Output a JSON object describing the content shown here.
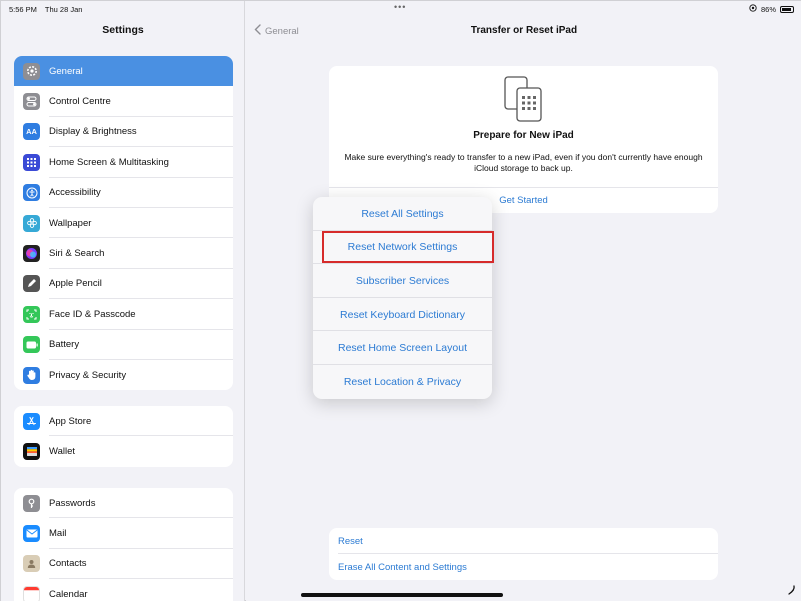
{
  "status": {
    "time": "5:56 PM",
    "date": "Thu 28 Jan",
    "battery": "86%",
    "dots": "•••"
  },
  "sidebar": {
    "title": "Settings",
    "groups": [
      [
        {
          "label": "General",
          "icon": "gear-icon",
          "color": "#8e8e93"
        },
        {
          "label": "Control Centre",
          "icon": "toggles-icon",
          "color": "#8e8e93"
        },
        {
          "label": "Display & Brightness",
          "icon": "text-size-icon",
          "color": "#2f7de1"
        },
        {
          "label": "Home Screen & Multitasking",
          "icon": "grid-icon",
          "color": "#3b4ad6"
        },
        {
          "label": "Accessibility",
          "icon": "accessibility-icon",
          "color": "#2f7de1"
        },
        {
          "label": "Wallpaper",
          "icon": "flower-icon",
          "color": "#36a9d6"
        },
        {
          "label": "Siri & Search",
          "icon": "siri-icon",
          "color": "#222222"
        },
        {
          "label": "Apple Pencil",
          "icon": "pencil-icon",
          "color": "#555555"
        },
        {
          "label": "Face ID & Passcode",
          "icon": "face-id-icon",
          "color": "#34c759"
        },
        {
          "label": "Battery",
          "icon": "battery-icon",
          "color": "#34c759"
        },
        {
          "label": "Privacy & Security",
          "icon": "hand-icon",
          "color": "#2f7de1"
        }
      ],
      [
        {
          "label": "App Store",
          "icon": "app-store-icon",
          "color": "#1a8cff"
        },
        {
          "label": "Wallet",
          "icon": "wallet-icon",
          "color": "#111111"
        }
      ],
      [
        {
          "label": "Passwords",
          "icon": "key-icon",
          "color": "#8e8e93"
        },
        {
          "label": "Mail",
          "icon": "mail-icon",
          "color": "#1a8cff"
        },
        {
          "label": "Contacts",
          "icon": "contacts-icon",
          "color": "#b5a48a"
        },
        {
          "label": "Calendar",
          "icon": "calendar-icon",
          "color": "#ffffff"
        }
      ]
    ]
  },
  "nav": {
    "back_label": "General",
    "title": "Transfer or Reset iPad"
  },
  "card": {
    "title": "Prepare for New iPad",
    "description": "Make sure everything's ready to transfer to a new iPad, even if you don't currently have enough iCloud storage to back up.",
    "link": "Get Started"
  },
  "menu": {
    "items": [
      "Reset All Settings",
      "Reset Network Settings",
      "Subscriber Services",
      "Reset Keyboard Dictionary",
      "Reset Home Screen Layout",
      "Reset Location & Privacy"
    ],
    "highlighted_index": 1,
    "highlight_color": "#d62b2b"
  },
  "reset_group": {
    "reset_label": "Reset",
    "erase_label": "Erase All Content and Settings"
  },
  "colors": {
    "accent": "#2c7bd3",
    "selected": "#4a90e2"
  }
}
